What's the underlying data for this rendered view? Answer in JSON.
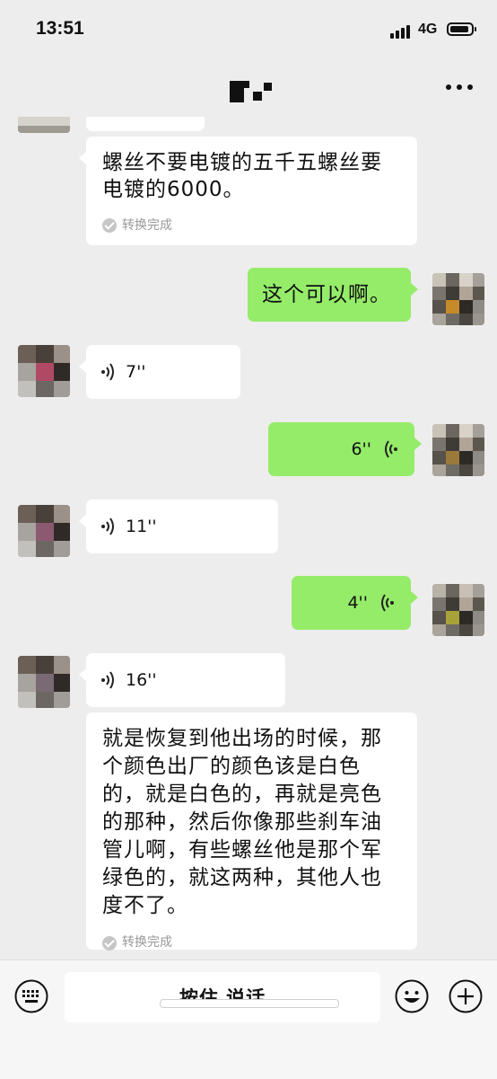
{
  "status_bar": {
    "time": "13:51",
    "network": "4G"
  },
  "header": {
    "more_icon": "more-dots-icon"
  },
  "colors": {
    "background": "#ededed",
    "incoming_bubble": "#ffffff",
    "outgoing_bubble": "#95ec69",
    "meta_text": "#999999"
  },
  "messages": [
    {
      "type": "text",
      "direction": "incoming",
      "lines": [
        "螺丝不要电镀的五千五螺丝要",
        "电镀的6000。"
      ],
      "status": "转换完成"
    },
    {
      "type": "text",
      "direction": "outgoing",
      "lines": [
        "这个可以啊。"
      ]
    },
    {
      "type": "voice",
      "direction": "incoming",
      "duration": "7''"
    },
    {
      "type": "voice",
      "direction": "outgoing",
      "duration": "6''"
    },
    {
      "type": "voice",
      "direction": "incoming",
      "duration": "11''"
    },
    {
      "type": "voice",
      "direction": "outgoing",
      "duration": "4''"
    },
    {
      "type": "voice",
      "direction": "incoming",
      "duration": "16''"
    },
    {
      "type": "text",
      "direction": "incoming",
      "lines": [
        "就是恢复到他出场的时候，那",
        "个颜色出厂的颜色该是白色",
        "的，就是白色的，再就是亮色",
        "的那种，然后你像那些刹车油",
        "管儿啊，有些螺丝他是那个军",
        "绿色的，就这两种，其他人也",
        "度不了。"
      ],
      "status": "转换完成"
    }
  ],
  "input_bar": {
    "hold_to_talk_label": "按住 说话"
  }
}
